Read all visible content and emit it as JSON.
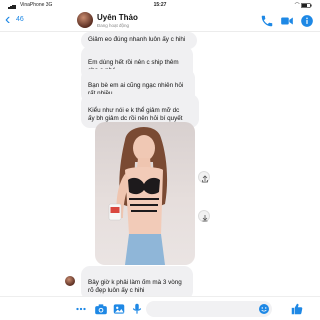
{
  "status_bar": {
    "carrier": "VinaPhone 3G",
    "time": "15:27",
    "battery": "%"
  },
  "header": {
    "back_count": "46",
    "contact_name": "Uyên Thảo",
    "contact_status": "Đang hoạt động",
    "icons": [
      "phone-icon",
      "video-call-icon",
      "info-icon"
    ]
  },
  "messages": [
    {
      "from": "contact",
      "text": "Giảm eo đúng nhanh luôn ấy c hihi"
    },
    {
      "from": "contact",
      "text": "Em dùng hết rồi nên c ship thêm\ncho e nhé"
    },
    {
      "from": "contact",
      "text": "Bạn bè em ai cũng ngạc nhiên hỏi\nrất nhiều"
    },
    {
      "from": "contact",
      "text": "Kiểu như nói e k thể giảm mỡ dc\nấy bh giảm dc rồi nên hỏi bí quyết"
    },
    {
      "from": "contact",
      "type": "photo"
    },
    {
      "from": "contact",
      "text": "Bây giờ k phải làm ốm mà 3 vòng\nrõ đẹp luôn ấy c hihi"
    }
  ],
  "composer": {
    "placeholder": "",
    "icons": [
      "more-icon",
      "camera-icon",
      "gallery-icon",
      "microphone-icon",
      "emoji-icon",
      "like-icon"
    ]
  },
  "colors": {
    "accent": "#1e88e5",
    "bubble": "#f0f0f2"
  }
}
